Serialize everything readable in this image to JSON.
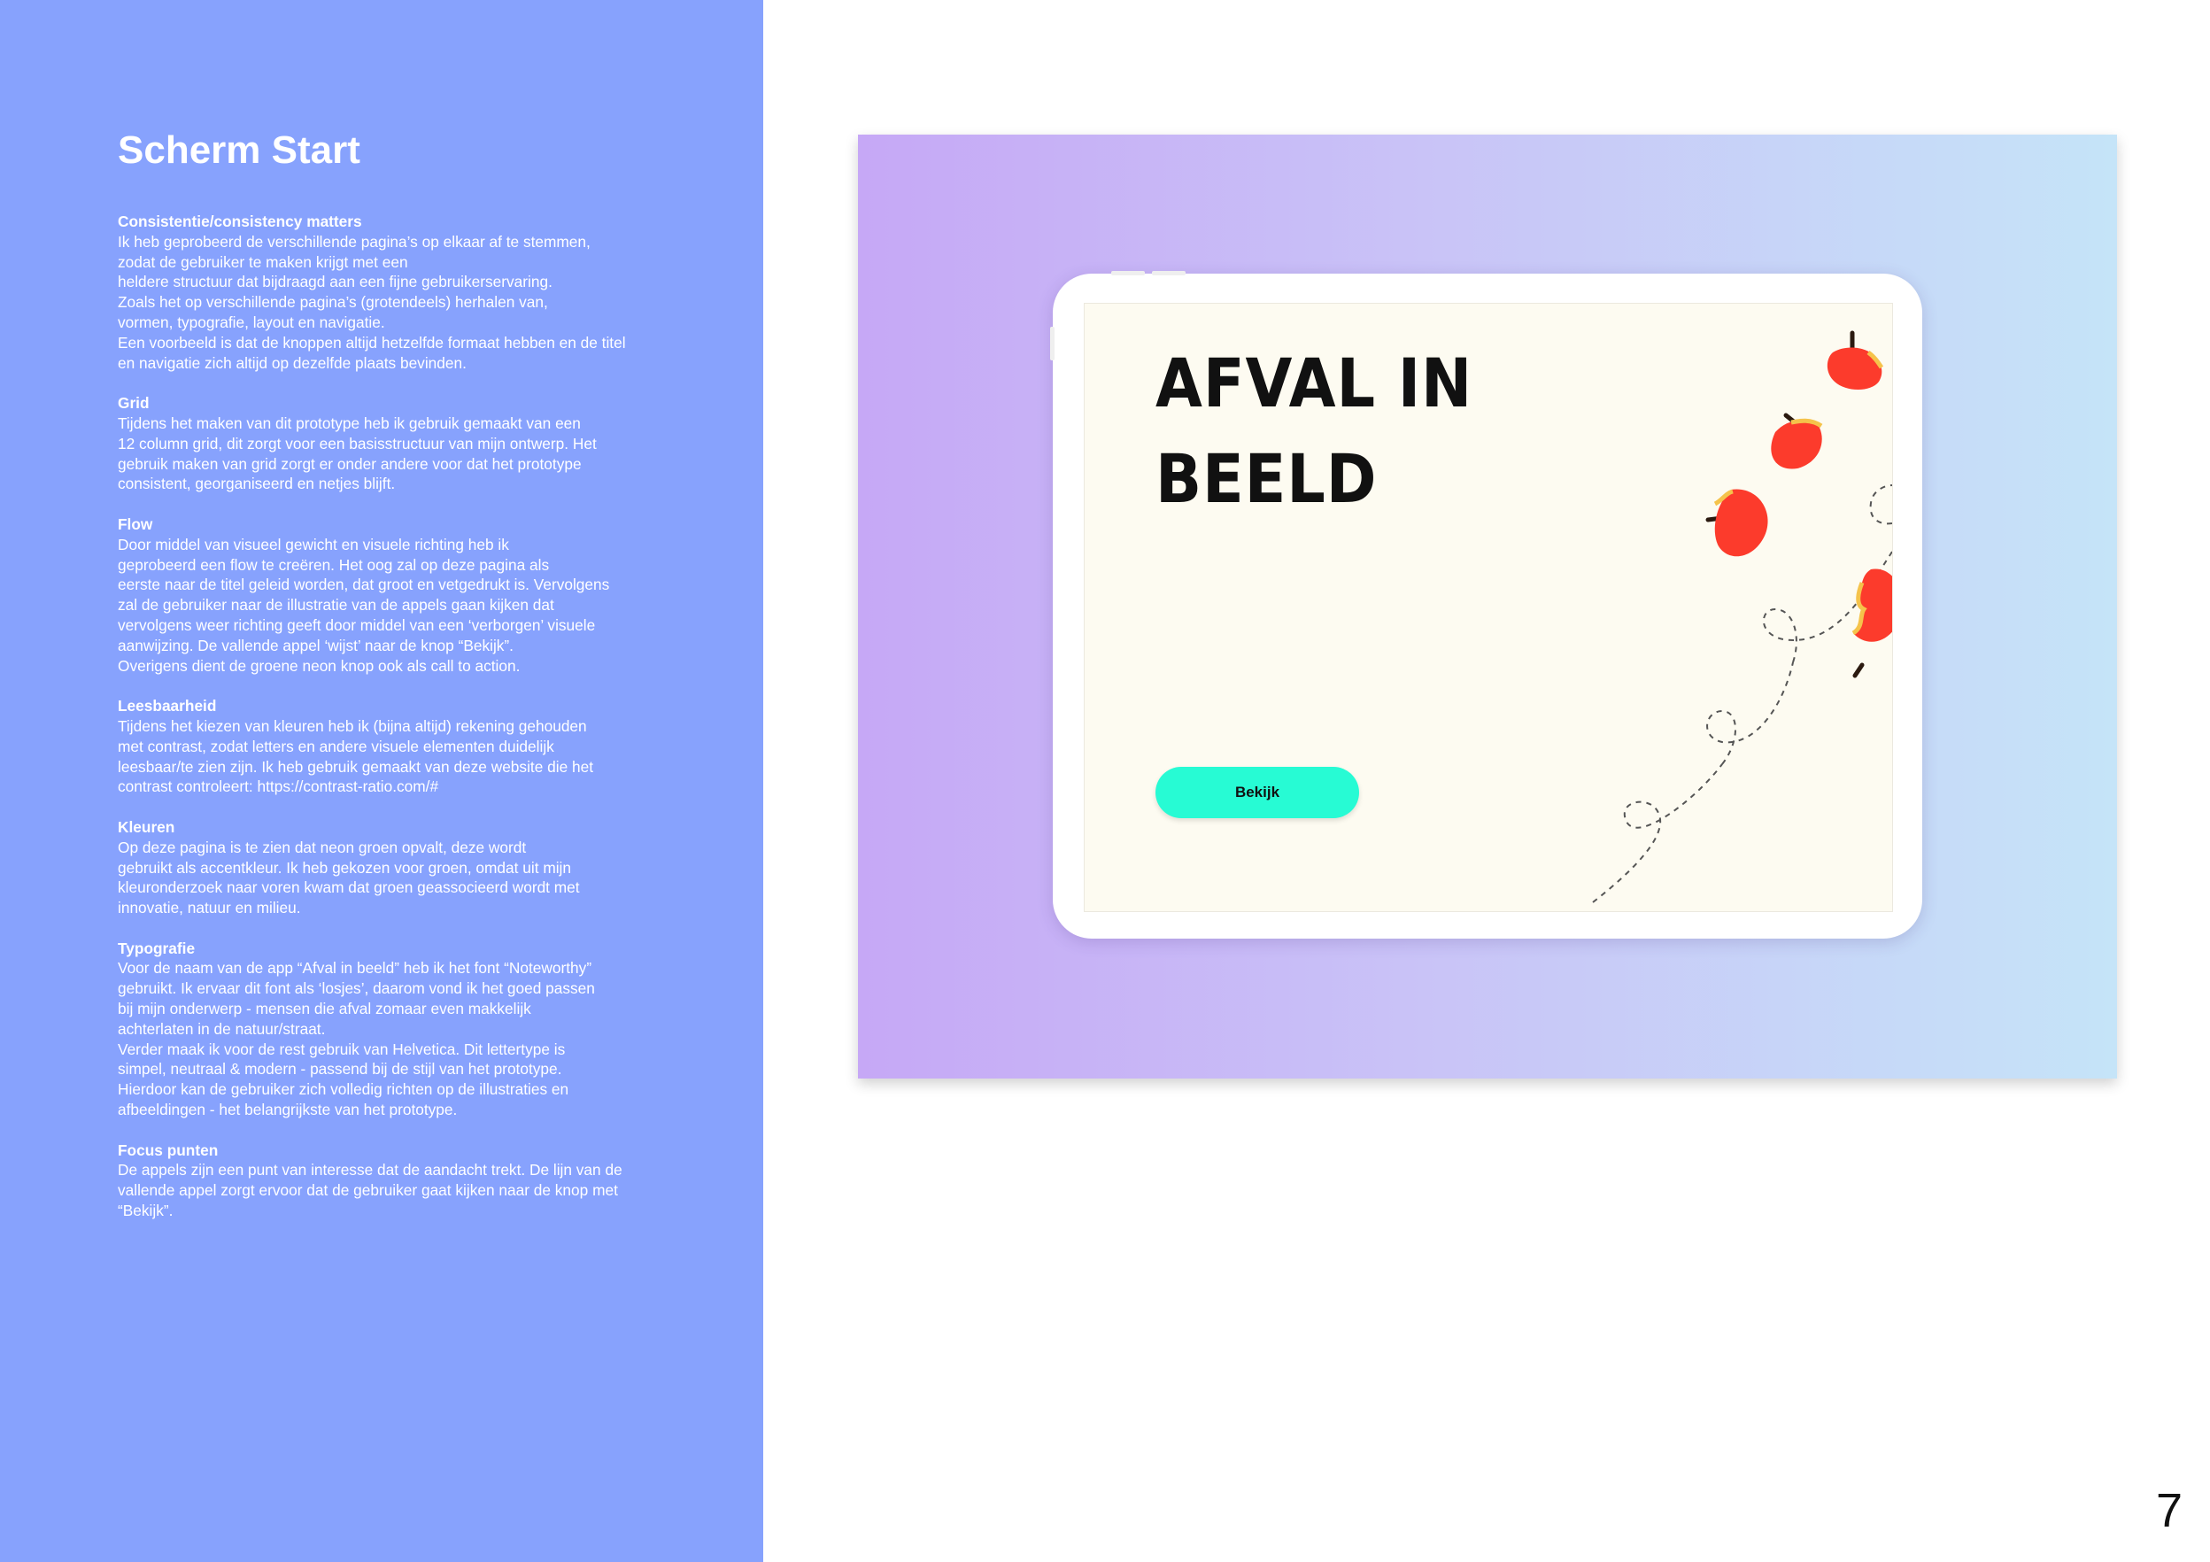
{
  "document": {
    "title": "Scherm Start",
    "page_number": "7"
  },
  "sections": [
    {
      "heading": "Consistentie/consistency matters",
      "lines": [
        "Ik heb geprobeerd de verschillende pagina’s op elkaar af te stemmen,",
        "zodat de gebruiker te maken krijgt met een",
        "heldere structuur dat bijdraagd aan een fijne gebruikerservaring.",
        "Zoals het op verschillende pagina’s (grotendeels) herhalen van,",
        "vormen, typografie, layout en navigatie.",
        "Een voorbeeld is dat de knoppen altijd hetzelfde formaat hebben en de titel",
        "en navigatie zich altijd op dezelfde plaats bevinden."
      ]
    },
    {
      "heading": "Grid",
      "lines": [
        "Tijdens het maken van dit prototype heb ik gebruik gemaakt van een",
        "12 column grid, dit zorgt voor een basisstructuur van mijn ontwerp. Het",
        "gebruik maken van grid zorgt er onder andere voor dat het prototype",
        "consistent, georganiseerd en netjes blijft."
      ]
    },
    {
      "heading": "Flow",
      "lines": [
        "Door middel van visueel gewicht en visuele richting heb ik",
        "geprobeerd een flow te creëren. Het oog zal op deze pagina als",
        "eerste naar de titel geleid worden, dat groot en vetgedrukt is. Vervolgens",
        "zal de gebruiker naar de illustratie van de appels gaan kijken dat",
        "vervolgens weer richting geeft door middel van een ‘verborgen’ visuele",
        "aanwijzing. De vallende appel ‘wijst’ naar de knop “Bekijk”.",
        "Overigens dient de groene neon knop ook als call to action."
      ]
    },
    {
      "heading": "Leesbaarheid",
      "lines": [
        "Tijdens het kiezen van kleuren heb ik (bijna altijd) rekening gehouden",
        "met contrast, zodat letters en andere visuele elementen duidelijk",
        "leesbaar/te zien zijn. Ik heb gebruik gemaakt van deze website die het",
        "contrast controleert: https://contrast-ratio.com/#"
      ]
    },
    {
      "heading": "Kleuren",
      "lines": [
        "Op deze pagina is te zien dat neon groen opvalt, deze wordt",
        "gebruikt als accentkleur. Ik heb gekozen voor groen, omdat uit mijn",
        "kleuronderzoek naar voren kwam dat groen geassocieerd wordt met",
        "innovatie, natuur en milieu."
      ]
    },
    {
      "heading": "Typografie",
      "lines": [
        "Voor de naam van de app “Afval in beeld” heb ik het font “Noteworthy”",
        "gebruikt. Ik ervaar dit font als ‘losjes’, daarom vond ik het goed passen",
        "bij mijn onderwerp - mensen die afval zomaar even makkelijk",
        "achterlaten in de natuur/straat.",
        "Verder maak ik voor de rest gebruik van Helvetica. Dit lettertype is",
        "simpel, neutraal & modern - passend bij de stijl van het prototype.",
        "Hierdoor kan de gebruiker zich volledig richten op de illustraties en",
        "afbeeldingen - het belangrijkste van het prototype."
      ]
    },
    {
      "heading": "Focus punten",
      "lines": [
        "De appels zijn een punt van interesse dat de aandacht trekt. De lijn van de",
        "vallende appel zorgt ervoor dat de gebruiker gaat kijken naar de knop met",
        "“Bekijk”."
      ]
    }
  ],
  "mockup": {
    "title_line_1": "AFVAL IN",
    "title_line_2": "BEELD",
    "button_label": "Bekijk",
    "illustration_icon": "falling-apple-icon"
  },
  "colors": {
    "left_panel": "#87a2fd",
    "button_accent": "#27fbd4",
    "apple_red": "#fc3b2c",
    "screen_background": "#fdfbf1"
  }
}
